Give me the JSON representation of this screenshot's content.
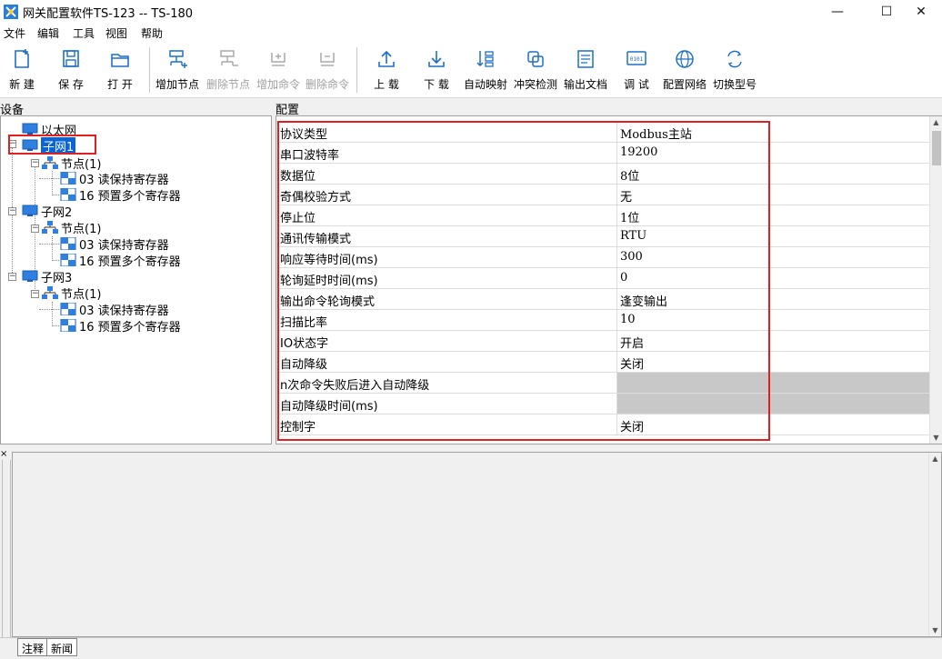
{
  "window": {
    "title": "网关配置软件TS-123 -- TS-180",
    "minimize": "—",
    "maximize": "☐",
    "close": "✕"
  },
  "menu": [
    "文件",
    "编辑",
    "工具",
    "视图",
    "帮助"
  ],
  "toolbar": {
    "new": "新 建",
    "save": "保 存",
    "open": "打 开",
    "add_node": "增加节点",
    "delete_node": "删除节点",
    "add_command": "增加命令",
    "delete_command": "删除命令",
    "upload": "上 载",
    "download": "下 载",
    "auto_map": "自动映射",
    "conflict_check": "冲突检测",
    "export_doc": "输出文档",
    "debug": "调 试",
    "config_network": "配置网络",
    "switch_model": "切换型号"
  },
  "panels": {
    "devices": "设备",
    "config": "配置"
  },
  "tree": {
    "ethernet": "以太网",
    "subnet1": "子网1",
    "subnet2": "子网2",
    "subnet3": "子网3",
    "node": "节点(1)",
    "cmd03": "03 读保持寄存器",
    "cmd16": "16 预置多个寄存器"
  },
  "properties": [
    {
      "name": "协议类型",
      "value": "Modbus主站"
    },
    {
      "name": "串口波特率",
      "value": "19200"
    },
    {
      "name": "数据位",
      "value": "8位"
    },
    {
      "name": "奇偶校验方式",
      "value": "无"
    },
    {
      "name": "停止位",
      "value": "1位"
    },
    {
      "name": "通讯传输模式",
      "value": "RTU"
    },
    {
      "name": "响应等待时间(ms)",
      "value": "300"
    },
    {
      "name": "轮询延时时间(ms)",
      "value": "0"
    },
    {
      "name": "输出命令轮询模式",
      "value": "逢变输出"
    },
    {
      "name": "扫描比率",
      "value": "10"
    },
    {
      "name": "IO状态字",
      "value": "开启"
    },
    {
      "name": "自动降级",
      "value": "关闭"
    },
    {
      "name": "n次命令失败后进入自动降级",
      "value": ""
    },
    {
      "name": "自动降级时间(ms)",
      "value": ""
    },
    {
      "name": "控制字",
      "value": "关闭"
    }
  ],
  "output": {
    "close_glyph": "×",
    "tabs": [
      "注释",
      "新闻"
    ]
  },
  "colors": {
    "selection": "#0a64d8",
    "highlight_border": "#e02020",
    "disabled_cell": "#c8c8c8",
    "icon_blue": "#1f6fc8"
  }
}
